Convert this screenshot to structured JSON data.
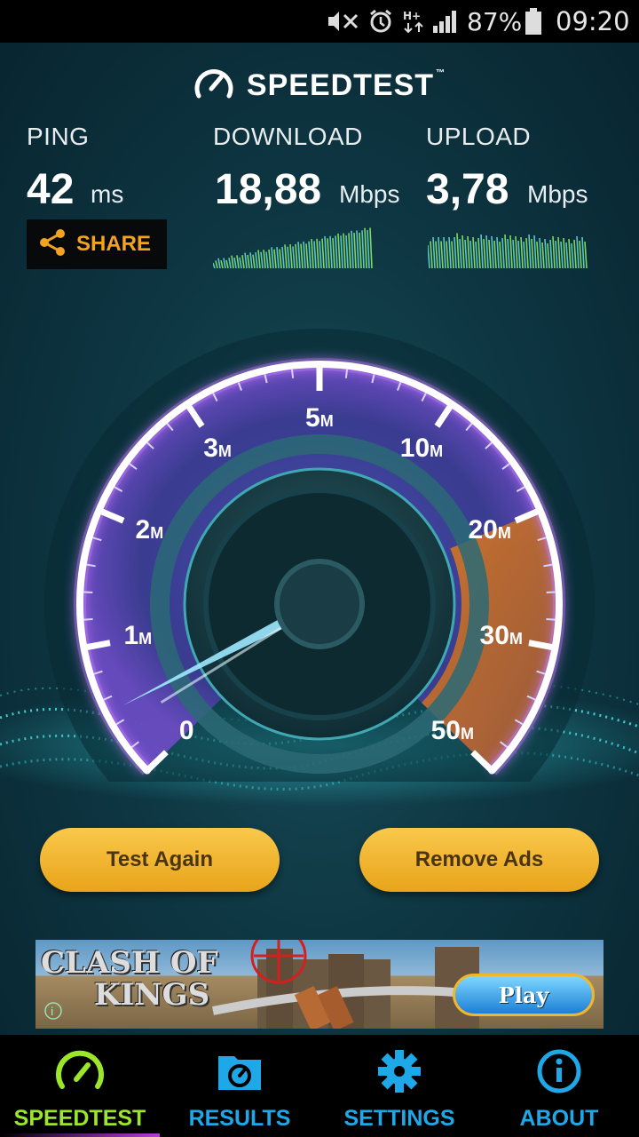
{
  "status_bar": {
    "battery_percent": "87%",
    "time": "09:20",
    "icons": [
      "mute-icon",
      "alarm-icon",
      "hplus-data-icon",
      "signal-icon",
      "battery-icon"
    ]
  },
  "header": {
    "logo_text": "SPEEDTEST",
    "trademark": "™"
  },
  "metrics": {
    "ping": {
      "label": "PING",
      "value": "42",
      "unit": "ms"
    },
    "download": {
      "label": "DOWNLOAD",
      "value": "18,88",
      "unit": "Mbps"
    },
    "upload": {
      "label": "UPLOAD",
      "value": "3,78",
      "unit": "Mbps"
    }
  },
  "share_button": {
    "label": "SHARE",
    "icon": "share-icon"
  },
  "gauge": {
    "ticks": [
      {
        "num": "0",
        "unit": ""
      },
      {
        "num": "1",
        "unit": "M"
      },
      {
        "num": "2",
        "unit": "M"
      },
      {
        "num": "3",
        "unit": "M"
      },
      {
        "num": "5",
        "unit": "M"
      },
      {
        "num": "10",
        "unit": "M"
      },
      {
        "num": "20",
        "unit": "M"
      },
      {
        "num": "30",
        "unit": "M"
      },
      {
        "num": "50",
        "unit": "M"
      }
    ],
    "needle_value_mbps": 0.5,
    "colors": {
      "arc": "#ffffff",
      "glow": "#b768ff",
      "zone": "#d2772a",
      "needle": "#9fe9ff"
    }
  },
  "buttons": {
    "test_again": "Test Again",
    "remove_ads": "Remove Ads"
  },
  "ad": {
    "title_line1": "CLASH OF",
    "title_line2": "KINGS",
    "play_label": "Play"
  },
  "nav": [
    {
      "label": "SPEEDTEST",
      "icon": "speedometer-icon",
      "active": true,
      "color": "#9be52a"
    },
    {
      "label": "RESULTS",
      "icon": "results-folder-icon",
      "active": false,
      "color": "#1fa8e8"
    },
    {
      "label": "SETTINGS",
      "icon": "gear-icon",
      "active": false,
      "color": "#1fa8e8"
    },
    {
      "label": "ABOUT",
      "icon": "info-icon",
      "active": false,
      "color": "#1fa8e8"
    }
  ]
}
